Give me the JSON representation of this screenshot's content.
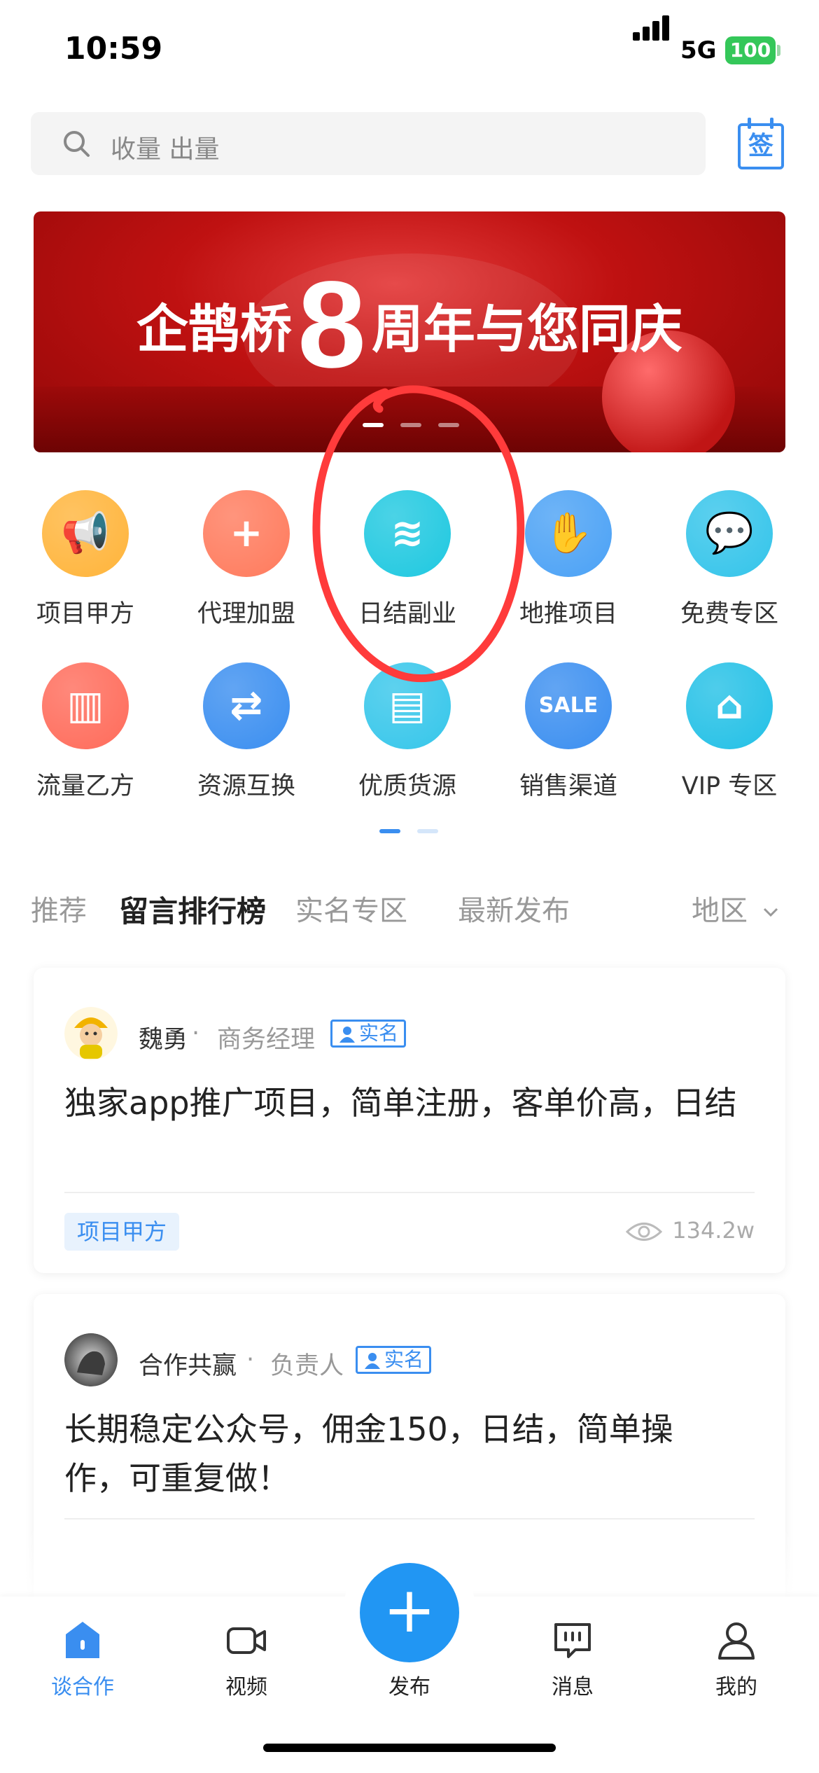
{
  "status_bar": {
    "time": "10:59",
    "network": "5G",
    "battery": "100"
  },
  "search": {
    "placeholder": "收量 出量"
  },
  "sign_button": {
    "label": "签"
  },
  "banner": {
    "text_left": "企鹊桥",
    "number": "8",
    "text_right": "周年与您同庆",
    "slides": 3,
    "active_slide": 1
  },
  "categories": [
    {
      "label": "项目甲方",
      "icon": "megaphone-icon",
      "color": "#ffb43a",
      "glyph": "📢"
    },
    {
      "label": "代理加盟",
      "icon": "plus-pin-icon",
      "color": "#ff7a5c",
      "glyph": "+"
    },
    {
      "label": "日结副业",
      "icon": "layers-icon",
      "color": "#1ec8e0",
      "glyph": "≋"
    },
    {
      "label": "地推项目",
      "icon": "handshake-icon",
      "color": "#4aa1f5",
      "glyph": "✋"
    },
    {
      "label": "免费专区",
      "icon": "chat-bubble-icon",
      "color": "#33c4ea",
      "glyph": "💬"
    },
    {
      "label": "流量乙方",
      "icon": "presentation-icon",
      "color": "#ff6b5a",
      "glyph": "▥"
    },
    {
      "label": "资源互换",
      "icon": "swap-icon",
      "color": "#3a8ef0",
      "glyph": "⇄"
    },
    {
      "label": "优质货源",
      "icon": "shopping-bag-icon",
      "color": "#35c6ea",
      "glyph": "▤"
    },
    {
      "label": "销售渠道",
      "icon": "sale-sign-icon",
      "color": "#3a8ef0",
      "glyph": "SALE"
    },
    {
      "label": "VIP 专区",
      "icon": "storefront-icon",
      "color": "#22c0e6",
      "glyph": "⌂"
    }
  ],
  "tabs": [
    "推荐",
    "留言排行榜",
    "实名专区",
    "最新发布"
  ],
  "active_tab": "留言排行榜",
  "region": {
    "label": "地区"
  },
  "posts": [
    {
      "author": "魏勇",
      "role": "商务经理",
      "badge": "实名",
      "content": "独家app推广项目，简单注册，客单价高，日结",
      "tag": "项目甲方",
      "views": "134.2w"
    },
    {
      "author": "合作共赢",
      "role": "负责人",
      "badge": "实名",
      "content": "长期稳定公众号，佣金150，日结，简单操作，可重复做！"
    }
  ],
  "bottom_nav": {
    "items": [
      {
        "label": "谈合作",
        "icon": "home-chat-icon"
      },
      {
        "label": "视频",
        "icon": "video-icon"
      },
      {
        "label": "发布",
        "icon": "plus-icon"
      },
      {
        "label": "消息",
        "icon": "message-icon"
      },
      {
        "label": "我的",
        "icon": "profile-icon"
      }
    ],
    "active": "谈合作"
  },
  "colors": {
    "accent": "#3a8ef0",
    "annotation": "#ff3b3b"
  }
}
